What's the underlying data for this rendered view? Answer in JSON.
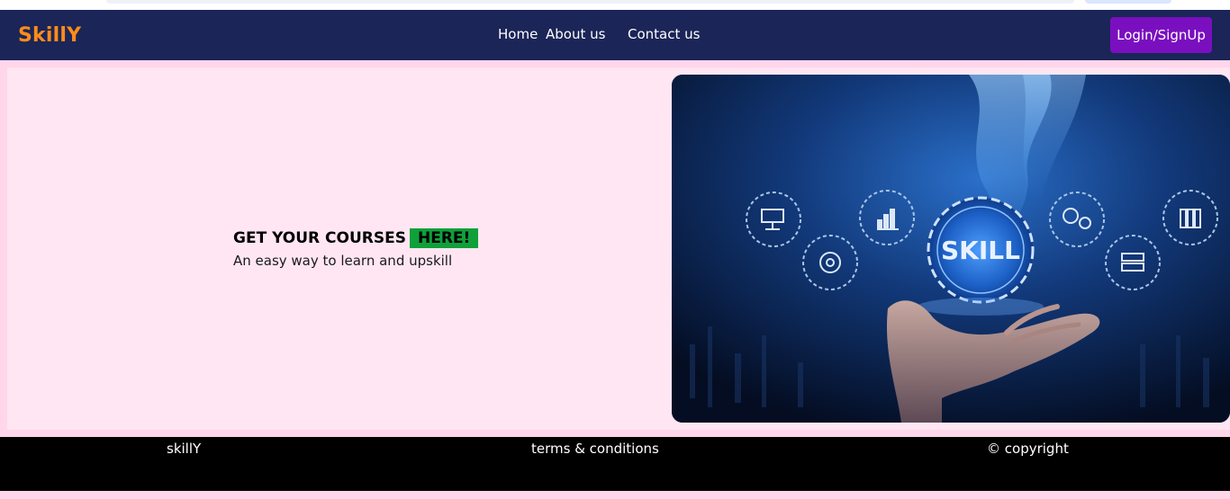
{
  "brand": {
    "name": "SkillY"
  },
  "nav": {
    "home": "Home",
    "about": "About us",
    "contact": "Contact us",
    "login": "Login/SignUp"
  },
  "hero": {
    "title": "GET YOUR COURSES",
    "highlight": "HERE!",
    "subtitle": "An easy way to learn and upskill",
    "image_text": "SKILL"
  },
  "footer": {
    "brand": "skillY",
    "terms": "terms & conditions",
    "copyright": "© copyright"
  },
  "colors": {
    "navbar": "#1b2557",
    "brand": "#ff8c1a",
    "login_button": "#7a0fbf",
    "highlight": "#0fa03a",
    "hero_background": "#ffe6f2",
    "footer": "#000000"
  }
}
